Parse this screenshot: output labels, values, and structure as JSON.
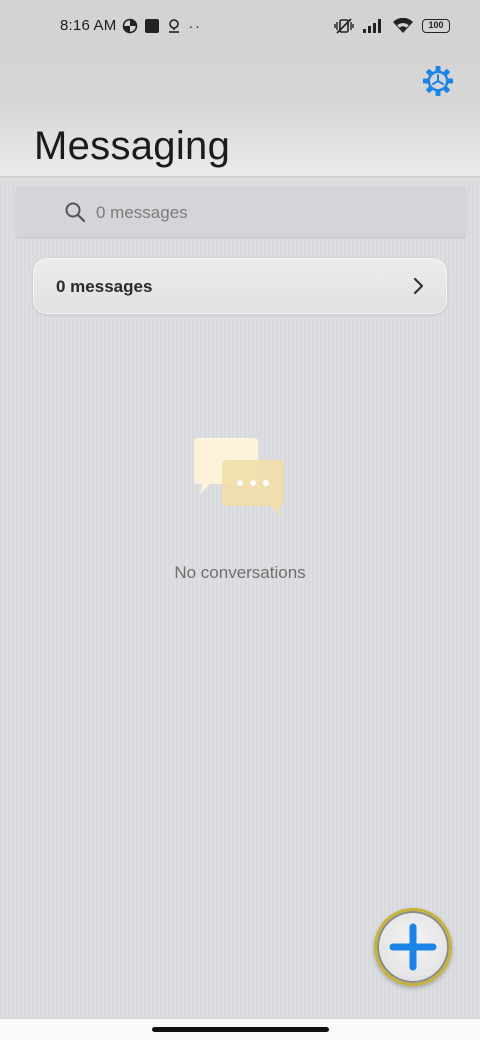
{
  "status_bar": {
    "time": "8:16 AM",
    "left_icons": [
      "data-saver-icon",
      "square-notification-icon",
      "location-pin-icon"
    ],
    "overflow_dots": "··",
    "right_icons": [
      "vibrate-mute-icon",
      "signal-icon",
      "wifi-icon"
    ],
    "battery": "100"
  },
  "header": {
    "title": "Messaging",
    "settings_icon": "gear-icon"
  },
  "search": {
    "placeholder": "0 messages",
    "icon": "search-icon"
  },
  "messages_row": {
    "label": "0 messages",
    "icon": "chevron-right-icon"
  },
  "empty_state": {
    "icon": "chat-bubbles-icon",
    "text": "No conversations"
  },
  "fab": {
    "icon": "plus-icon"
  },
  "colors": {
    "accent": "#1a84e8",
    "background": "#dbdcdf",
    "illustration_front": "#fdf2da",
    "illustration_back": "#f1dea8"
  }
}
